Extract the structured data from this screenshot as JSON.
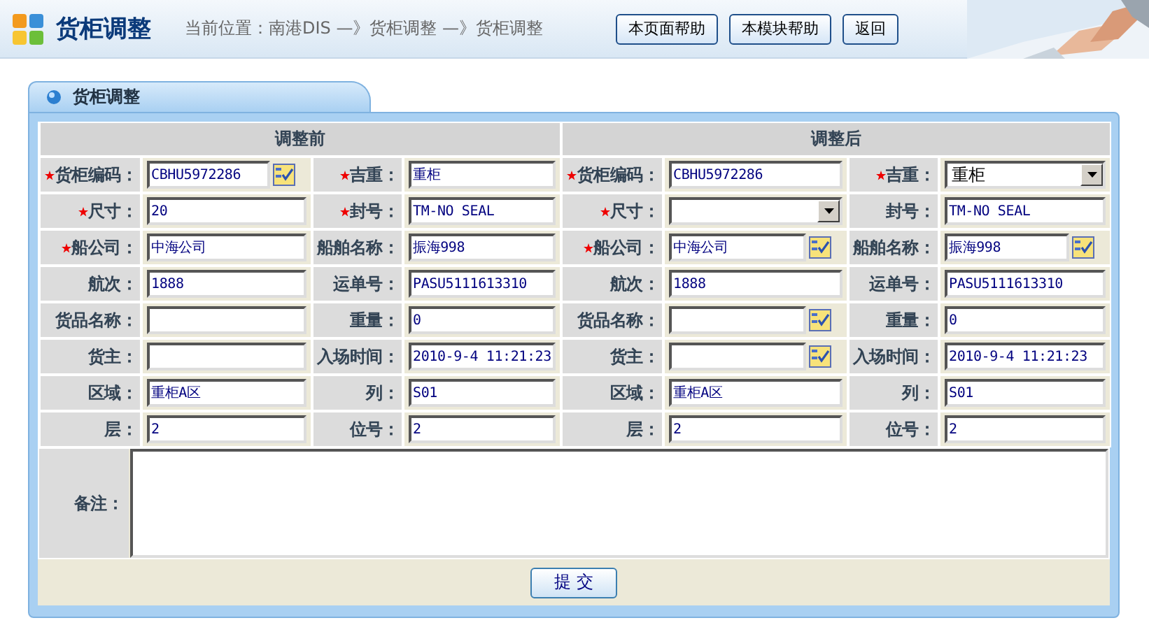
{
  "header": {
    "title": "货柜调整",
    "breadcrumb": "当前位置：南港DIS —》货柜调整 —》货柜调整",
    "buttons": [
      "本页面帮助",
      "本模块帮助",
      "返回"
    ]
  },
  "panel": {
    "title": "货柜调整"
  },
  "sections": [
    {
      "title": "调整前",
      "rows": [
        [
          {
            "label": "货柜编码：",
            "required": true,
            "kind": "lookup",
            "value": "CBHU5972286"
          },
          {
            "label": "吉重：",
            "required": true,
            "kind": "text",
            "value": "重柜"
          }
        ],
        [
          {
            "label": "尺寸：",
            "required": true,
            "kind": "text",
            "value": "20"
          },
          {
            "label": "封号：",
            "required": true,
            "kind": "text",
            "value": "TM-NO SEAL"
          }
        ],
        [
          {
            "label": "船公司：",
            "required": true,
            "kind": "text",
            "value": "中海公司"
          },
          {
            "label": "船舶名称：",
            "required": false,
            "kind": "text",
            "value": "振海998"
          }
        ],
        [
          {
            "label": "航次：",
            "required": false,
            "kind": "text",
            "value": "1888"
          },
          {
            "label": "运单号：",
            "required": false,
            "kind": "text",
            "value": "PASU5111613310"
          }
        ],
        [
          {
            "label": "货品名称：",
            "required": false,
            "kind": "text"
          },
          {
            "label": "重量：",
            "required": false,
            "kind": "text",
            "value": "0"
          }
        ],
        [
          {
            "label": "货主：",
            "required": false,
            "kind": "text"
          },
          {
            "label": "入场时间：",
            "required": false,
            "kind": "text",
            "value": "2010-9-4 11:21:23"
          }
        ],
        [
          {
            "label": "区域：",
            "required": false,
            "kind": "text",
            "value": "重柜A区"
          },
          {
            "label": "列：",
            "required": false,
            "kind": "text",
            "value": "S01"
          }
        ],
        [
          {
            "label": "层：",
            "required": false,
            "kind": "text",
            "value": "2"
          },
          {
            "label": "位号：",
            "required": false,
            "kind": "text",
            "value": "2"
          }
        ]
      ]
    },
    {
      "title": "调整后",
      "rows": [
        [
          {
            "label": "货柜编码：",
            "required": true,
            "kind": "text",
            "value": "CBHU5972286"
          },
          {
            "label": "吉重：",
            "required": true,
            "kind": "select",
            "value": "重柜"
          }
        ],
        [
          {
            "label": "尺寸：",
            "required": true,
            "kind": "select"
          },
          {
            "label": "封号：",
            "required": false,
            "kind": "text",
            "value": "TM-NO SEAL"
          }
        ],
        [
          {
            "label": "船公司：",
            "required": true,
            "kind": "lookup",
            "value": "中海公司"
          },
          {
            "label": "船舶名称：",
            "required": false,
            "kind": "lookup",
            "value": "振海998"
          }
        ],
        [
          {
            "label": "航次：",
            "required": false,
            "kind": "text",
            "value": "1888"
          },
          {
            "label": "运单号：",
            "required": false,
            "kind": "text",
            "value": "PASU5111613310"
          }
        ],
        [
          {
            "label": "货品名称：",
            "required": false,
            "kind": "lookup"
          },
          {
            "label": "重量：",
            "required": false,
            "kind": "text",
            "value": "0"
          }
        ],
        [
          {
            "label": "货主：",
            "required": false,
            "kind": "lookup"
          },
          {
            "label": "入场时间：",
            "required": false,
            "kind": "text",
            "value": "2010-9-4 11:21:23"
          }
        ],
        [
          {
            "label": "区域：",
            "required": false,
            "kind": "text",
            "value": "重柜A区"
          },
          {
            "label": "列：",
            "required": false,
            "kind": "text",
            "value": "S01"
          }
        ],
        [
          {
            "label": "层：",
            "required": false,
            "kind": "text",
            "value": "2"
          },
          {
            "label": "位号：",
            "required": false,
            "kind": "text",
            "value": "2"
          }
        ]
      ]
    }
  ],
  "remarks": {
    "label": "备注："
  },
  "submit": "提 交"
}
